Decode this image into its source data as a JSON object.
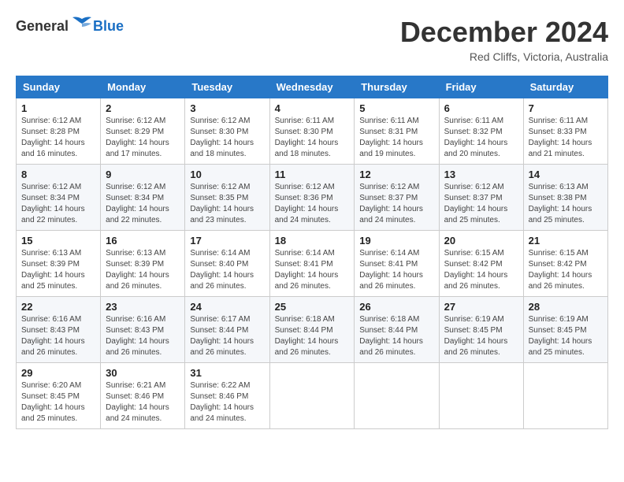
{
  "header": {
    "logo_general": "General",
    "logo_blue": "Blue",
    "month_title": "December 2024",
    "location": "Red Cliffs, Victoria, Australia"
  },
  "days_of_week": [
    "Sunday",
    "Monday",
    "Tuesday",
    "Wednesday",
    "Thursday",
    "Friday",
    "Saturday"
  ],
  "weeks": [
    [
      {
        "day": "1",
        "sunrise": "6:12 AM",
        "sunset": "8:28 PM",
        "daylight": "14 hours and 16 minutes."
      },
      {
        "day": "2",
        "sunrise": "6:12 AM",
        "sunset": "8:29 PM",
        "daylight": "14 hours and 17 minutes."
      },
      {
        "day": "3",
        "sunrise": "6:12 AM",
        "sunset": "8:30 PM",
        "daylight": "14 hours and 18 minutes."
      },
      {
        "day": "4",
        "sunrise": "6:11 AM",
        "sunset": "8:30 PM",
        "daylight": "14 hours and 18 minutes."
      },
      {
        "day": "5",
        "sunrise": "6:11 AM",
        "sunset": "8:31 PM",
        "daylight": "14 hours and 19 minutes."
      },
      {
        "day": "6",
        "sunrise": "6:11 AM",
        "sunset": "8:32 PM",
        "daylight": "14 hours and 20 minutes."
      },
      {
        "day": "7",
        "sunrise": "6:11 AM",
        "sunset": "8:33 PM",
        "daylight": "14 hours and 21 minutes."
      }
    ],
    [
      {
        "day": "8",
        "sunrise": "6:12 AM",
        "sunset": "8:34 PM",
        "daylight": "14 hours and 22 minutes."
      },
      {
        "day": "9",
        "sunrise": "6:12 AM",
        "sunset": "8:34 PM",
        "daylight": "14 hours and 22 minutes."
      },
      {
        "day": "10",
        "sunrise": "6:12 AM",
        "sunset": "8:35 PM",
        "daylight": "14 hours and 23 minutes."
      },
      {
        "day": "11",
        "sunrise": "6:12 AM",
        "sunset": "8:36 PM",
        "daylight": "14 hours and 24 minutes."
      },
      {
        "day": "12",
        "sunrise": "6:12 AM",
        "sunset": "8:37 PM",
        "daylight": "14 hours and 24 minutes."
      },
      {
        "day": "13",
        "sunrise": "6:12 AM",
        "sunset": "8:37 PM",
        "daylight": "14 hours and 25 minutes."
      },
      {
        "day": "14",
        "sunrise": "6:13 AM",
        "sunset": "8:38 PM",
        "daylight": "14 hours and 25 minutes."
      }
    ],
    [
      {
        "day": "15",
        "sunrise": "6:13 AM",
        "sunset": "8:39 PM",
        "daylight": "14 hours and 25 minutes."
      },
      {
        "day": "16",
        "sunrise": "6:13 AM",
        "sunset": "8:39 PM",
        "daylight": "14 hours and 26 minutes."
      },
      {
        "day": "17",
        "sunrise": "6:14 AM",
        "sunset": "8:40 PM",
        "daylight": "14 hours and 26 minutes."
      },
      {
        "day": "18",
        "sunrise": "6:14 AM",
        "sunset": "8:41 PM",
        "daylight": "14 hours and 26 minutes."
      },
      {
        "day": "19",
        "sunrise": "6:14 AM",
        "sunset": "8:41 PM",
        "daylight": "14 hours and 26 minutes."
      },
      {
        "day": "20",
        "sunrise": "6:15 AM",
        "sunset": "8:42 PM",
        "daylight": "14 hours and 26 minutes."
      },
      {
        "day": "21",
        "sunrise": "6:15 AM",
        "sunset": "8:42 PM",
        "daylight": "14 hours and 26 minutes."
      }
    ],
    [
      {
        "day": "22",
        "sunrise": "6:16 AM",
        "sunset": "8:43 PM",
        "daylight": "14 hours and 26 minutes."
      },
      {
        "day": "23",
        "sunrise": "6:16 AM",
        "sunset": "8:43 PM",
        "daylight": "14 hours and 26 minutes."
      },
      {
        "day": "24",
        "sunrise": "6:17 AM",
        "sunset": "8:44 PM",
        "daylight": "14 hours and 26 minutes."
      },
      {
        "day": "25",
        "sunrise": "6:18 AM",
        "sunset": "8:44 PM",
        "daylight": "14 hours and 26 minutes."
      },
      {
        "day": "26",
        "sunrise": "6:18 AM",
        "sunset": "8:44 PM",
        "daylight": "14 hours and 26 minutes."
      },
      {
        "day": "27",
        "sunrise": "6:19 AM",
        "sunset": "8:45 PM",
        "daylight": "14 hours and 26 minutes."
      },
      {
        "day": "28",
        "sunrise": "6:19 AM",
        "sunset": "8:45 PM",
        "daylight": "14 hours and 25 minutes."
      }
    ],
    [
      {
        "day": "29",
        "sunrise": "6:20 AM",
        "sunset": "8:45 PM",
        "daylight": "14 hours and 25 minutes."
      },
      {
        "day": "30",
        "sunrise": "6:21 AM",
        "sunset": "8:46 PM",
        "daylight": "14 hours and 24 minutes."
      },
      {
        "day": "31",
        "sunrise": "6:22 AM",
        "sunset": "8:46 PM",
        "daylight": "14 hours and 24 minutes."
      },
      null,
      null,
      null,
      null
    ]
  ],
  "labels": {
    "sunrise": "Sunrise:",
    "sunset": "Sunset:",
    "daylight": "Daylight:"
  }
}
